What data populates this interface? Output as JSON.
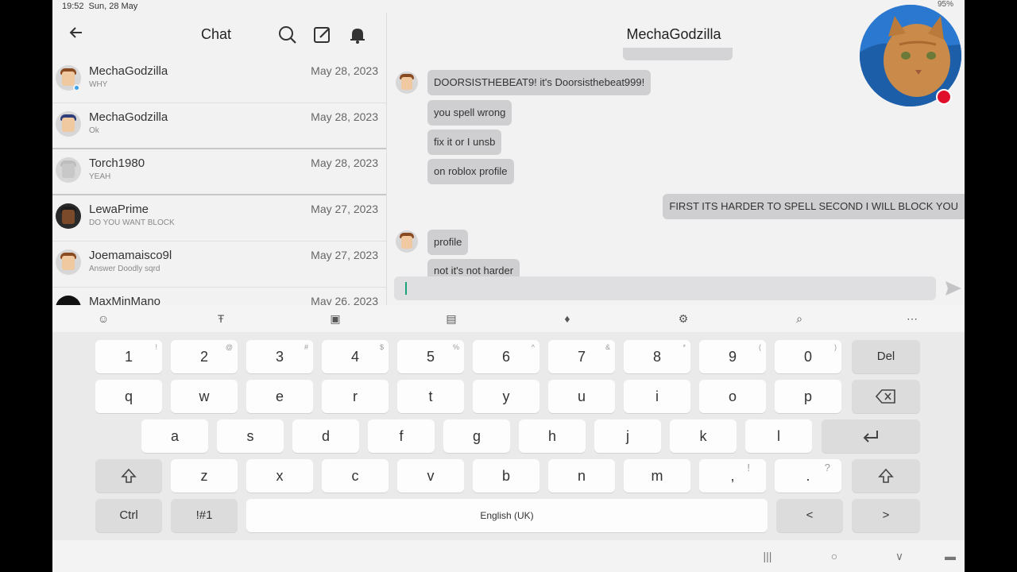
{
  "status": {
    "time": "19:52",
    "date": "Sun, 28 May",
    "right": "95%"
  },
  "list_header": {
    "title": "Chat"
  },
  "chats": [
    {
      "name": "MechaGodzilla",
      "preview": "WHY",
      "date": "May 28, 2023",
      "hair": "#8a4a22",
      "online": true
    },
    {
      "name": "MechaGodzilla",
      "preview": "Ok",
      "date": "May 28, 2023",
      "hair": "#2d3e7a",
      "online": false
    },
    {
      "name": "Torch1980",
      "preview": "YEAH",
      "date": "May 28, 2023",
      "hair": "#bdbdbd",
      "online": false
    },
    {
      "name": "LewaPrime",
      "preview": "DO YOU WANT BLOCK",
      "date": "May 27, 2023",
      "hair": "#1d1d1d",
      "online": false
    },
    {
      "name": "Joemamaisco9l",
      "preview": "Answer Doodly sqrd",
      "date": "May 27, 2023",
      "hair": "#8a4a22",
      "online": false
    },
    {
      "name": "MaxMinMano",
      "preview": "",
      "date": "May 26, 2023",
      "hair": "#111111",
      "online": false
    }
  ],
  "conversation": {
    "title": "MechaGodzilla",
    "messages": [
      {
        "text": "DOORSISTHEBEAT9! it's Doorsisthebeat999!"
      },
      {
        "text": "you spell wrong"
      },
      {
        "text": "fix it or I unsb"
      },
      {
        "text": "on roblox profile"
      },
      {
        "text": "FIRST ITS HARDER TO SPELL SECOND I WILL BLOCK YOU"
      },
      {
        "text": "profile"
      },
      {
        "text": "not it's not harder"
      }
    ],
    "input_value": ""
  },
  "keyboard": {
    "row1": [
      {
        "k": "1",
        "s": "!"
      },
      {
        "k": "2",
        "s": "@"
      },
      {
        "k": "3",
        "s": "#"
      },
      {
        "k": "4",
        "s": "$"
      },
      {
        "k": "5",
        "s": "%"
      },
      {
        "k": "6",
        "s": "^"
      },
      {
        "k": "7",
        "s": "&"
      },
      {
        "k": "8",
        "s": "*"
      },
      {
        "k": "9",
        "s": "("
      },
      {
        "k": "0",
        "s": ")"
      }
    ],
    "del": "Del",
    "row2": [
      "q",
      "w",
      "e",
      "r",
      "t",
      "y",
      "u",
      "i",
      "o",
      "p"
    ],
    "row3": [
      "a",
      "s",
      "d",
      "f",
      "g",
      "h",
      "j",
      "k",
      "l"
    ],
    "row4": [
      "z",
      "x",
      "c",
      "v",
      "b",
      "n",
      "m"
    ],
    "comma": ",",
    "comma_sup": "!",
    "period": ".",
    "period_sup": "?",
    "ctrl": "Ctrl",
    "symbols": "!#1",
    "space": "English (UK)",
    "left": "<",
    "right": ">"
  }
}
